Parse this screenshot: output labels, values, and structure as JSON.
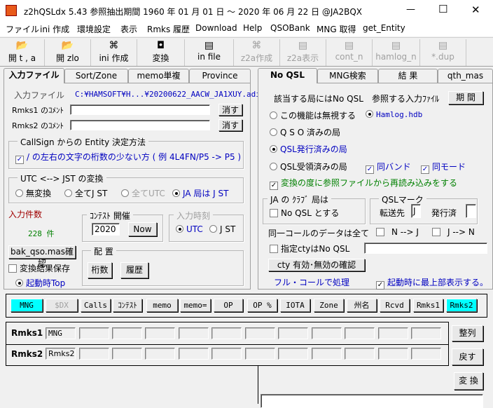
{
  "window": {
    "title": "z2hQSLdx  5.43   参照抽出期間 1960 年 01 月 01 日  ～ 2020 年 06 月 22 日     @JA2BQX",
    "minimize": "—",
    "maximize": "☐",
    "close": "✕"
  },
  "menu": [
    "ファイル",
    "ini 作成",
    "環境設定",
    "表示",
    "Rmks 履歴",
    "Download",
    "Help",
    "QSOBank",
    "MNG 取得",
    "get_Entity"
  ],
  "toolbar": [
    {
      "label": "開 t , a",
      "icon": "open-folder-icon",
      "enabled": true
    },
    {
      "label": "開 zlo",
      "icon": "open-folder-icon",
      "enabled": true
    },
    {
      "label": "ini 作成",
      "icon": "hierarchy-icon",
      "enabled": true
    },
    {
      "label": "変換",
      "icon": "convert-icon",
      "enabled": true
    },
    {
      "label": "in file",
      "icon": "document-icon",
      "enabled": true
    },
    {
      "label": "z2a作成",
      "icon": "hierarchy-icon",
      "enabled": false
    },
    {
      "label": "z2a表示",
      "icon": "document-icon",
      "enabled": false
    },
    {
      "label": "cont_n",
      "icon": "document-icon",
      "enabled": false
    },
    {
      "label": "hamlog_n",
      "icon": "document-icon",
      "enabled": false
    },
    {
      "label": "*.dup",
      "icon": "document-icon",
      "enabled": false
    }
  ],
  "left": {
    "tabs": [
      "入力ファイル",
      "Sort/Zone",
      "memo単複",
      "Province"
    ],
    "input_file_label": "入力ファイル",
    "input_file_path": "C:¥HAMSOFT¥H...¥20200622_AACW_JA1XUY.adi",
    "rmks1_label": "Rmks1 のｺﾒﾝﾄ",
    "rmks1_value": "",
    "rmks2_label": "Rmks2 のｺﾒﾝﾄ",
    "rmks2_value": "",
    "clear_label": "消す",
    "entity_group": "CallSign からの Entity 決定方法",
    "entity_check": "/ の左右の文字の桁数の少ない方 ( 例  4L4FN/P5 -> P5 )",
    "utc_group": "UTC <--> JST の変換",
    "utc_options": [
      "無変換",
      "全てJ ST",
      "全てUTC",
      "JA 局は J ST"
    ],
    "utc_selected": 3,
    "count_label": "入力件数",
    "count_value": "228 件",
    "contest_group": "ｺﾝﾃｽﾄ 開催",
    "contest_year": "2020",
    "now_label": "Now",
    "time_group": "入力時刻",
    "time_options": [
      "UTC",
      "J ST"
    ],
    "time_selected": 0,
    "bak_button": "bak_qso.mas確認",
    "save_check": "変換結果保存",
    "top_radio": "起動時Top",
    "layout_group": "配  置",
    "digits_button": "桁数",
    "history_button": "履歴"
  },
  "right": {
    "tabs": [
      "No QSL",
      "MNG検索",
      "結 果",
      "qth_mas"
    ],
    "noqsl_label": "該当する局にはNo QSL",
    "ref_label": "参照する入力ﾌｧｲﾙ",
    "period_button": "期 間",
    "opt_ignore": "この機能は無視する",
    "opt_hamlog": "Hamlog.hdb",
    "opt_qso": "Q S O   済みの局",
    "opt_issued": "QSL発行済みの局",
    "opt_received": "QSL受領済みの局",
    "same_band": "同バンド",
    "same_mode": "同モード",
    "reload_check": "変換の度に参照ファイルから再読み込みをする",
    "ja_group": "JA の ｸﾗﾌﾞ 局は",
    "ja_check": "No QSL とする",
    "mark_group": "QSLマーク",
    "forward_label": "転送先",
    "forward_value": "J",
    "issued_label": "発行済",
    "issued_value": "",
    "same_call_label": "同一コールのデータは全て",
    "n_to_j": "N --> J",
    "j_to_n": "J --> N",
    "cty_check": "指定ctyはNo QSL",
    "cty_value": "",
    "cty_button": "cty  有効･無効の確認",
    "fullcall_label": "フル・コールで処理",
    "top_check": "起動時に最上部表示する。"
  },
  "fields": [
    {
      "label": "MNG",
      "highlight": true,
      "enabled": true
    },
    {
      "label": "$DX",
      "highlight": false,
      "enabled": false
    },
    {
      "label": "Calls",
      "highlight": false,
      "enabled": true
    },
    {
      "label": "ｺﾝﾃｽﾄ",
      "highlight": false,
      "enabled": true
    },
    {
      "label": "memo",
      "highlight": false,
      "enabled": true
    },
    {
      "label": "memo=",
      "highlight": false,
      "enabled": true
    },
    {
      "label": "OP",
      "highlight": false,
      "enabled": true
    },
    {
      "label": "OP %",
      "highlight": false,
      "enabled": true
    },
    {
      "label": "IOTA",
      "highlight": false,
      "enabled": true
    },
    {
      "label": "Zone",
      "highlight": false,
      "enabled": true
    },
    {
      "label": "州名",
      "highlight": false,
      "enabled": true
    },
    {
      "label": "Rcvd",
      "highlight": false,
      "enabled": true
    },
    {
      "label": "Rmks1",
      "highlight": false,
      "enabled": true
    },
    {
      "label": "Rmks2",
      "highlight": true,
      "enabled": true
    }
  ],
  "rmks": {
    "row1_label": "Rmks1",
    "row1": [
      "MNG",
      "",
      "",
      "",
      "",
      "",
      "",
      "",
      "",
      "",
      "",
      ""
    ],
    "row2_label": "Rmks2",
    "row2": [
      "Rmks2",
      "",
      "",
      "",
      "",
      "",
      "",
      "",
      "",
      "",
      "",
      ""
    ],
    "sort_button": "整列",
    "restore_button": "戻す"
  },
  "convert_button": "変 換",
  "colors": {
    "highlight": "#00ffff",
    "link": "#0000c0",
    "green": "#008000",
    "count_label": "#a00000"
  }
}
